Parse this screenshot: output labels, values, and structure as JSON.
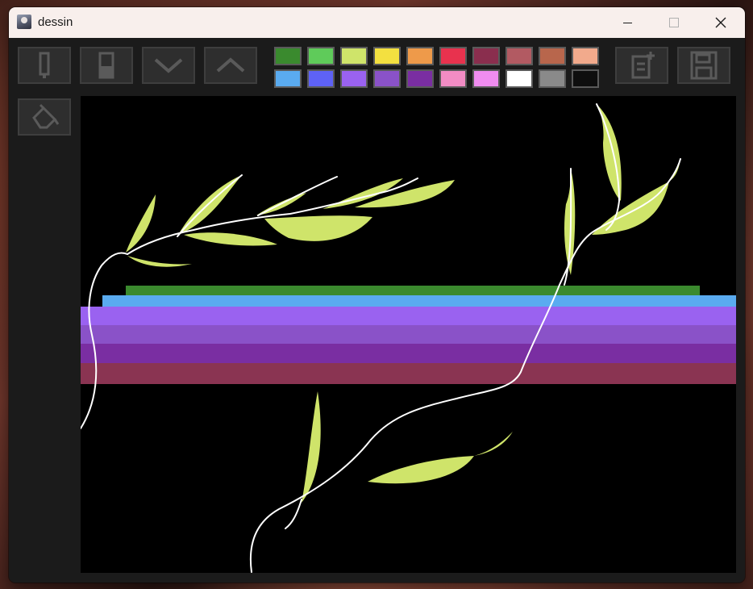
{
  "window": {
    "title": "dessin"
  },
  "titlebar": {
    "minimize_icon": "minimize-icon",
    "maximize_icon": "maximize-icon",
    "close_icon": "close-icon"
  },
  "tools": [
    {
      "name": "pen-tool",
      "icon": "pen-icon"
    },
    {
      "name": "eraser-tool",
      "icon": "eraser-icon"
    },
    {
      "name": "size-down",
      "icon": "chevron-down-icon"
    },
    {
      "name": "size-up",
      "icon": "chevron-up-icon"
    },
    {
      "name": "fill-tool",
      "icon": "paint-bucket-icon"
    },
    {
      "name": "new-canvas",
      "icon": "new-document-icon"
    },
    {
      "name": "save",
      "icon": "save-icon"
    }
  ],
  "palette": {
    "row1": [
      "#3a8a2e",
      "#5fcb5a",
      "#cfe46a",
      "#f3e040",
      "#ee9a4a",
      "#e8324e",
      "#8a2e4e",
      "#b25a62",
      "#b8664c",
      "#f2aa8c"
    ],
    "row2": [
      "#5aabf0",
      "#5e62f6",
      "#9a62f0",
      "#8a52c8",
      "#7a2ea2",
      "#f28cc4",
      "#f08cf0",
      "#ffffff",
      "#8a8a8a",
      "#0e0e0e"
    ]
  },
  "stripes": [
    "#3b8a2e",
    "#5aabf0",
    "#9a62f0",
    "#8a52c8",
    "#7a2ea2",
    "#8a3452"
  ]
}
